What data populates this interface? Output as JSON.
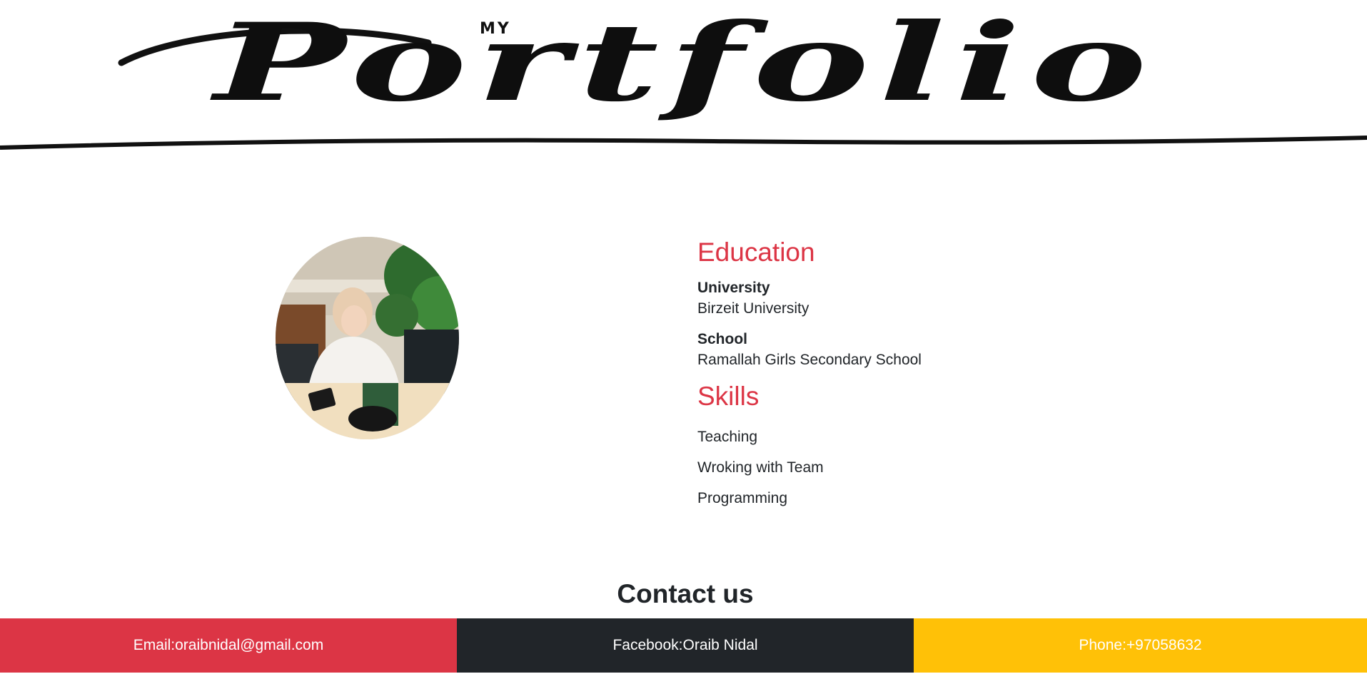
{
  "banner": {
    "small_text": "MY",
    "script_text": "Portfolio",
    "ink_color": "#0e0e0e"
  },
  "profile": {
    "photo_icon": "profile-photo"
  },
  "education": {
    "title": "Education",
    "items": [
      {
        "label": "University",
        "value": "Birzeit University"
      },
      {
        "label": "School",
        "value": "Ramallah Girls Secondary School"
      }
    ]
  },
  "skills": {
    "title": "Skills",
    "items": [
      "Teaching",
      "Wroking with Team",
      "Programming"
    ]
  },
  "contact": {
    "heading": "Contact us",
    "email": "Email:oraibnidal@gmail.com",
    "facebook": "Facebook:Oraib Nidal",
    "phone": "Phone:+97058632"
  },
  "colors": {
    "accent": "#dc3545",
    "dark": "#212529",
    "warning": "#ffc107"
  }
}
